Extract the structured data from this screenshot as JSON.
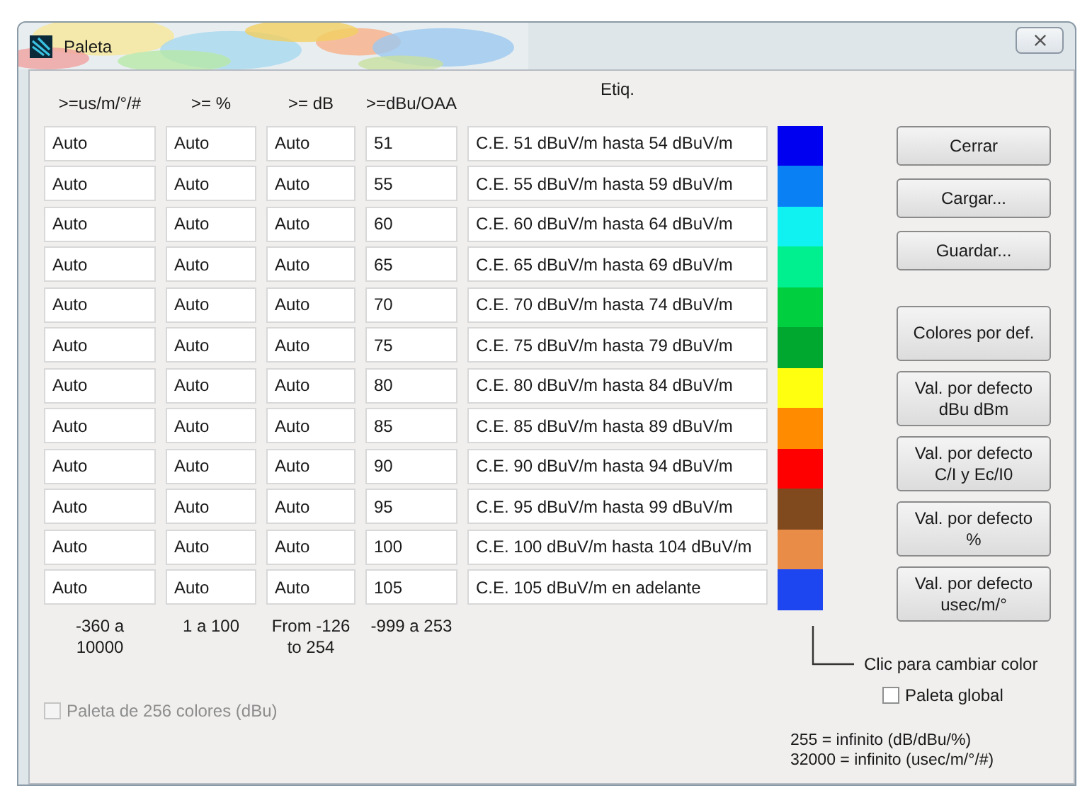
{
  "window": {
    "title": "Paleta"
  },
  "columns": [
    ">=us/m/°/#",
    ">= %",
    ">= dB",
    ">=dBu/OAA",
    "Etiq."
  ],
  "rows": [
    {
      "cells": [
        "Auto",
        "Auto",
        "Auto",
        "51"
      ],
      "label": "C.E. 51 dBuV/m hasta 54 dBuV/m",
      "color": "#0000f0"
    },
    {
      "cells": [
        "Auto",
        "Auto",
        "Auto",
        "55"
      ],
      "label": "C.E. 55 dBuV/m hasta 59 dBuV/m",
      "color": "#0a80f5"
    },
    {
      "cells": [
        "Auto",
        "Auto",
        "Auto",
        "60"
      ],
      "label": "C.E. 60 dBuV/m hasta 64 dBuV/m",
      "color": "#10f2f2"
    },
    {
      "cells": [
        "Auto",
        "Auto",
        "Auto",
        "65"
      ],
      "label": "C.E. 65 dBuV/m hasta 69 dBuV/m",
      "color": "#00f090"
    },
    {
      "cells": [
        "Auto",
        "Auto",
        "Auto",
        "70"
      ],
      "label": "C.E. 70 dBuV/m hasta 74 dBuV/m",
      "color": "#00d040"
    },
    {
      "cells": [
        "Auto",
        "Auto",
        "Auto",
        "75"
      ],
      "label": "C.E. 75 dBuV/m hasta 79 dBuV/m",
      "color": "#00a830"
    },
    {
      "cells": [
        "Auto",
        "Auto",
        "Auto",
        "80"
      ],
      "label": "C.E. 80 dBuV/m hasta 84 dBuV/m",
      "color": "#ffff10"
    },
    {
      "cells": [
        "Auto",
        "Auto",
        "Auto",
        "85"
      ],
      "label": "C.E. 85 dBuV/m hasta 89 dBuV/m",
      "color": "#ff8c00"
    },
    {
      "cells": [
        "Auto",
        "Auto",
        "Auto",
        "90"
      ],
      "label": "C.E. 90 dBuV/m hasta 94 dBuV/m",
      "color": "#ff0000"
    },
    {
      "cells": [
        "Auto",
        "Auto",
        "Auto",
        "95"
      ],
      "label": "C.E. 95 dBuV/m hasta 99 dBuV/m",
      "color": "#80491e"
    },
    {
      "cells": [
        "Auto",
        "Auto",
        "Auto",
        "100"
      ],
      "label": "C.E. 100 dBuV/m hasta 104 dBuV/m",
      "color": "#e88c48"
    },
    {
      "cells": [
        "Auto",
        "Auto",
        "Auto",
        "105"
      ],
      "label": "C.E. 105 dBuV/m en adelante",
      "color": "#1e46f0"
    }
  ],
  "ranges": [
    "-360 a\n10000",
    "1 a 100",
    "From -126\nto 254",
    "-999 a 253"
  ],
  "buttons": [
    {
      "label": "Cerrar",
      "kind": "small"
    },
    {
      "label": "Cargar...",
      "kind": "small"
    },
    {
      "label": "Guardar...",
      "kind": "small"
    },
    {
      "label": "Colores por def.",
      "kind": "tall"
    },
    {
      "label": "Val. por defecto\ndBu dBm",
      "kind": "tall"
    },
    {
      "label": "Val. por defecto\nC/I y Ec/I0",
      "kind": "tall"
    },
    {
      "label": "Val. por defecto\n%",
      "kind": "tall"
    },
    {
      "label": "Val. por defecto\nusec/m/°",
      "kind": "tall"
    }
  ],
  "palette_256": {
    "label": "Paleta de 256 colores (dBu)",
    "checked": false,
    "disabled": true
  },
  "color_hint": "Clic para cambiar color",
  "global_palette": {
    "label": "Paleta global",
    "checked": false
  },
  "notes": [
    "255 = infinito (dB/dBu/%)",
    "32000 = infinito (usec/m/°/#)"
  ]
}
